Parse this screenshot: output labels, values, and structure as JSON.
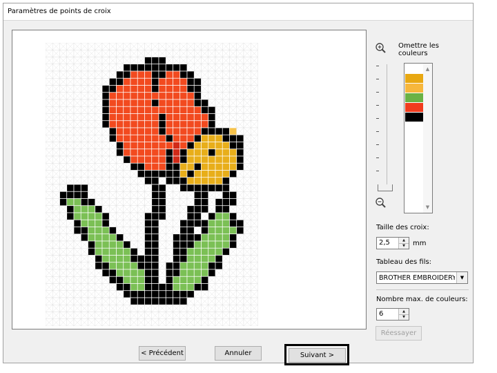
{
  "window": {
    "title": "Paramètres de points de croix"
  },
  "omit_colors_label": "Omettre les couleurs",
  "color_list": [
    "#e8a812",
    "#f7b73c",
    "#6ab245",
    "#f03c1e",
    "#000000"
  ],
  "cross_size": {
    "label": "Taille des croix:",
    "value": "2,5",
    "unit": "mm"
  },
  "thread_chart": {
    "label": "Tableau des fils:",
    "value": "BROTHER EMBROIDERY"
  },
  "max_colors": {
    "label": "Nombre max. de couleurs:",
    "value": "6"
  },
  "buttons": {
    "retry": "Réessayer",
    "previous": "< Précédent",
    "cancel": "Annuler",
    "next": "Suivant >"
  },
  "pattern": {
    "legend": {
      ".": "#ffffff",
      "K": "#000000",
      "R": "#f24a1f",
      "D": "#d12a18",
      "Y": "#e8ae1a",
      "S": "#f6c24a",
      "G": "#7bc055"
    },
    "rows": [
      "..............................",
      "..............................",
      "..............KKK.............",
      "...........KKKKKKKKK..........",
      "..........KKRRRKKRRKK.........",
      ".........KKRRRRKRRRRKK........",
      "........KKRRRRRKRRRRKK........",
      "........KRRRRRRRRRRRRK........",
      "........KRRRRRRKRRRRRKK.......",
      "........KRRRRRRRRRRRRRKK......",
      "........KRRRRRRRKRRRRRRK......",
      "........KRRRRRRRKRRRRRRK......",
      ".........KRRRRRRKRRRRRKKKKS...",
      ".........KRRRRRRRKRRRKYYYKKK..",
      "..........KRRRRRRRDRKYYYYYKK..",
      "..........KRRRRRRKDKYYYKYYYK..",
      "...........KRRRRRKDKYYYYYYYK..",
      "............KKRRRKKYYKYYYYYK..",
      ".............KKKKKKYKYYYYYK...",
      "..............KK.KKKYYYYYK....",
      "...KKK.........KK..KKKKKKK....",
      "..KKKK.........KK....KK..KK...",
      "..KGGKK........KK....KK.KKK...",
      "...KGGGK.......KK...KKK.KK....",
      "...KGGGGK.....KKK...KK.KGGK...",
      "....KGGGK.....KK...KKKKGGGKK..",
      "....KKGGGK....KK...KK.KGGGGK..",
      ".....KGGGGK...KK..KKKKGGGGK...",
      "......KGGGGK..KK..KKKGGGGGK...",
      "......KGGGGGK.KK..KKGGGGGK....",
      ".......KGGGGKKKK..KKGGGGK.....",
      ".......KKGGGGKKK.KKGGGGKK.....",
      "........KKGGGGKK.KKGGGGK......",
      ".........KKGGGKK.KGGGGK.......",
      "..........KKGGKKKKGGGKK.......",
      "...........KKKKKKKKKK.........",
      "............KKKKKKKK..........",
      "..............................",
      "..............................",
      ".............................."
    ]
  }
}
